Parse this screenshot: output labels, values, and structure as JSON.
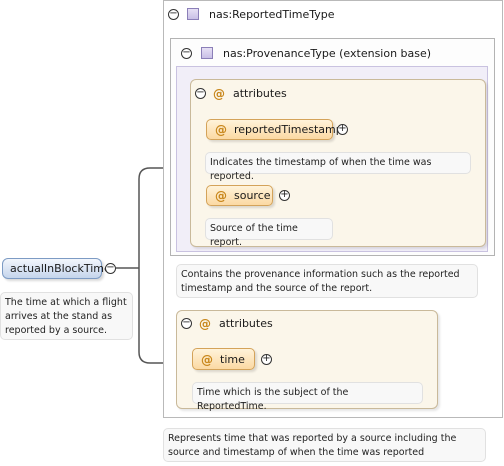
{
  "root_element": {
    "name": "actualInBlockTime",
    "doc": "The time at which a flight arrives at the stand as reported by a source."
  },
  "type": {
    "name": "nas:ReportedTimeType",
    "doc": "Represents time that was reported by a source including the source and timestamp of when the time was reported"
  },
  "extension": {
    "name": "nas:ProvenanceType (extension base)",
    "doc": "Contains the provenance information such as the reported timestamp and the source of the report.",
    "attributes_label": "attributes",
    "attributes": [
      {
        "name": "reportedTimestamp",
        "doc": "Indicates the timestamp of when the time was reported."
      },
      {
        "name": "source",
        "doc": "Source of the time report."
      }
    ]
  },
  "own_attributes": {
    "label": "attributes",
    "items": [
      {
        "name": "time",
        "doc": "Time which is the subject of the ReportedTime."
      }
    ]
  },
  "icons": {
    "collapse": "minus-circle-icon",
    "expand": "plus-circle-icon",
    "type": "complex-type-icon",
    "attribute": "at-sign-icon"
  },
  "glyphs": {
    "minus": "−",
    "plus": "+",
    "at": "@"
  }
}
